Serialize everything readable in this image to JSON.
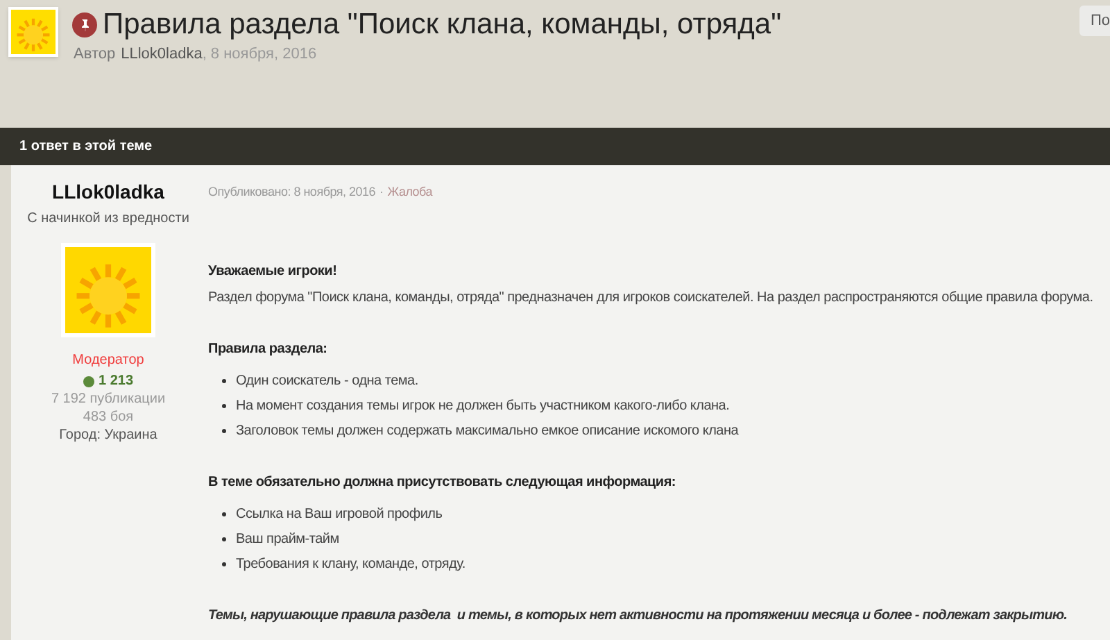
{
  "topic": {
    "title": "Правила раздела \"Поиск клана, команды, отряда\"",
    "author_prefix": "Автор",
    "author": "LLlok0ladka",
    "date": ", 8 ноября, 2016",
    "pinned": true,
    "button": "По"
  },
  "replies_bar": {
    "text": "1 ответ в этой теме"
  },
  "post": {
    "user": {
      "name": "LLlok0ladka",
      "title": "С начинкой из вредности",
      "role": "Модератор",
      "reputation": "1 213",
      "posts": "7 192 публикации",
      "battles": "483 боя",
      "city": "Город: Украина"
    },
    "published": "Опубликовано: 8 ноября, 2016",
    "separator": "·",
    "report": "Жалоба",
    "body": [
      {
        "kind": "heading",
        "text": "Уважаемые игроки!"
      },
      {
        "kind": "paragraph",
        "text": "Раздел форума \"Поиск клана, команды, отряда\" предназначен для игроков соискателей. На раздел распространяются общие правила форума."
      },
      {
        "kind": "heading",
        "text": "Правила раздела:"
      },
      {
        "kind": "list",
        "items": [
          "Один соискатель - одна тема.",
          "На момент создания темы игрок не должен быть участником какого-либо клана.",
          "Заголовок темы должен содержать максимально емкое описание искомого клана"
        ]
      },
      {
        "kind": "heading",
        "text": "В теме обязательно должна присутствовать следующая информация:"
      },
      {
        "kind": "list",
        "items": [
          "Ссылка на Ваш игровой профиль",
          "Ваш прайм-тайм",
          "Требования к клану, команде, отряду."
        ]
      },
      {
        "kind": "note",
        "text": "Темы, нарушающие правила раздела  и темы, в которых нет активности на протяжении месяца и более - подлежат закрытию."
      }
    ]
  }
}
